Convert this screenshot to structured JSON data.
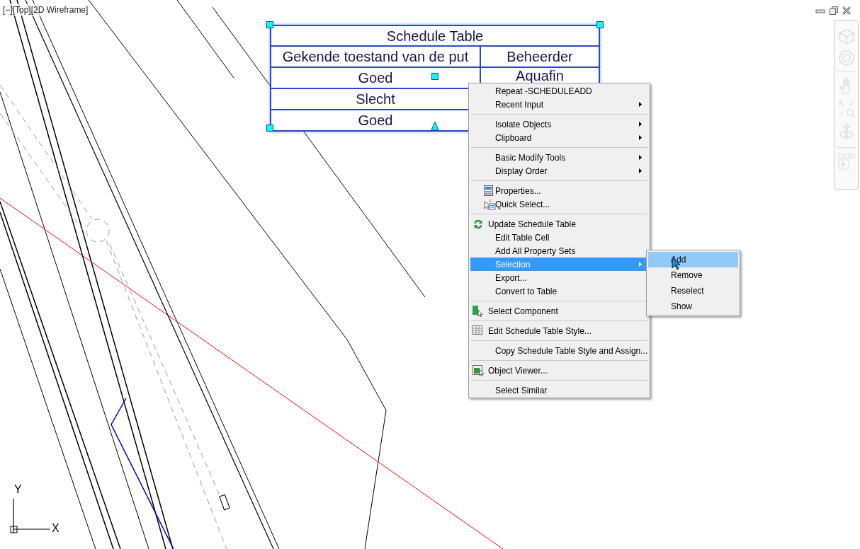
{
  "viewport_controls": [
    "[−]",
    "[Top]",
    "[2D Wireframe]"
  ],
  "schedule_table": {
    "title": "Schedule Table",
    "columns": [
      "Gekende toestand van de put",
      "Beheerder"
    ],
    "rows": [
      [
        "Goed",
        "Aquafin"
      ],
      [
        "Slecht"
      ],
      [
        "Goed"
      ]
    ]
  },
  "context_menu": {
    "items": [
      {
        "kind": "item",
        "label": "Repeat -SCHEDULEADD",
        "submenu": false,
        "selected": false
      },
      {
        "kind": "item",
        "label": "Recent Input",
        "submenu": true,
        "selected": false
      },
      {
        "kind": "separator"
      },
      {
        "kind": "item",
        "label": "Isolate Objects",
        "submenu": true,
        "selected": false
      },
      {
        "kind": "item",
        "label": "Clipboard",
        "submenu": true,
        "selected": false
      },
      {
        "kind": "separator"
      },
      {
        "kind": "item",
        "label": "Basic Modify Tools",
        "submenu": true,
        "selected": false
      },
      {
        "kind": "item",
        "label": "Display Order",
        "submenu": true,
        "selected": false
      },
      {
        "kind": "separator"
      },
      {
        "kind": "item",
        "label": "Properties...",
        "submenu": false,
        "selected": false
      },
      {
        "kind": "item",
        "label": "Quick Select...",
        "submenu": false,
        "selected": false
      },
      {
        "kind": "separator"
      },
      {
        "kind": "item",
        "label": "Update Schedule Table",
        "submenu": false,
        "selected": false
      },
      {
        "kind": "item",
        "label": "Edit Table Cell",
        "submenu": false,
        "selected": false
      },
      {
        "kind": "item",
        "label": "Add All Property Sets",
        "submenu": false,
        "selected": false
      },
      {
        "kind": "item",
        "label": "Selection",
        "submenu": true,
        "selected": true
      },
      {
        "kind": "item",
        "label": "Export...",
        "submenu": false,
        "selected": false
      },
      {
        "kind": "item",
        "label": "Convert to Table",
        "submenu": false,
        "selected": false
      },
      {
        "kind": "separator"
      },
      {
        "kind": "item",
        "label": "Select Component",
        "submenu": false,
        "selected": false
      },
      {
        "kind": "separator"
      },
      {
        "kind": "item",
        "label": "Edit Schedule Table Style...",
        "submenu": false,
        "selected": false
      },
      {
        "kind": "separator"
      },
      {
        "kind": "item",
        "label": "Copy Schedule Table Style and Assign...",
        "submenu": false,
        "selected": false
      },
      {
        "kind": "separator"
      },
      {
        "kind": "item",
        "label": "Object Viewer...",
        "submenu": false,
        "selected": false
      },
      {
        "kind": "separator"
      },
      {
        "kind": "item",
        "label": "Select Similar",
        "submenu": false,
        "selected": false
      }
    ]
  },
  "submenu": {
    "items": [
      {
        "label": "Add",
        "selected": true
      },
      {
        "label": "Remove",
        "selected": false
      },
      {
        "label": "Reselect",
        "selected": false
      },
      {
        "label": "Show",
        "selected": false
      }
    ]
  },
  "ucs": {
    "x_label": "X",
    "y_label": "Y"
  }
}
